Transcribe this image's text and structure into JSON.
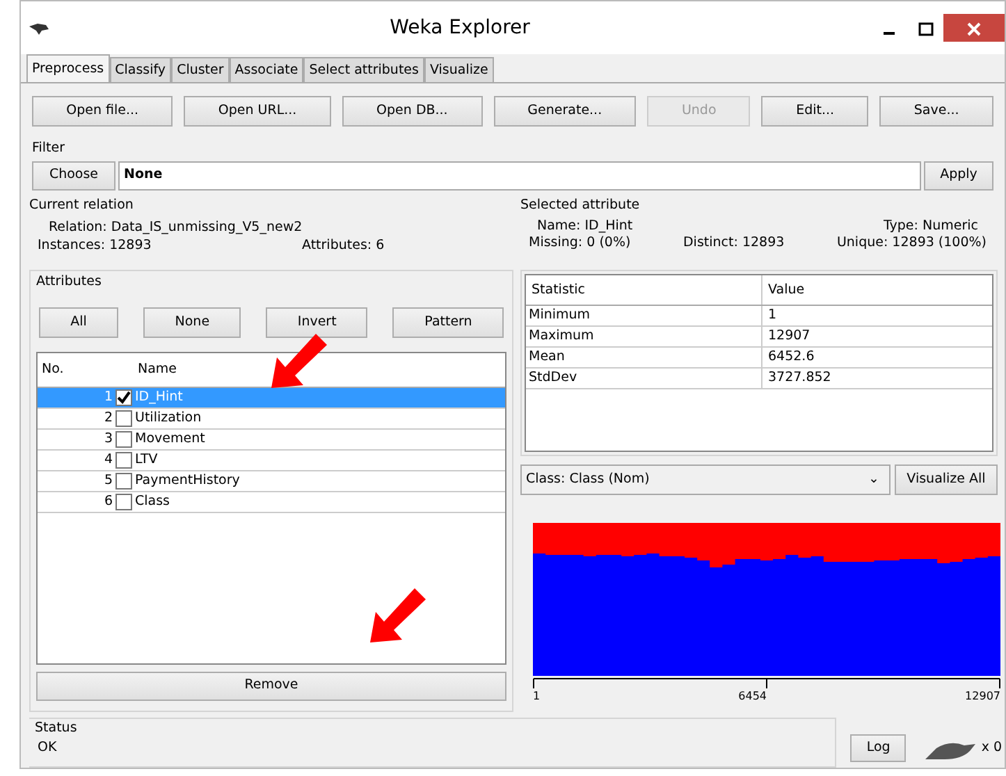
{
  "window": {
    "title": "Weka Explorer"
  },
  "tabs": [
    {
      "label": "Preprocess",
      "selected": true
    },
    {
      "label": "Classify",
      "selected": false
    },
    {
      "label": "Cluster",
      "selected": false
    },
    {
      "label": "Associate",
      "selected": false
    },
    {
      "label": "Select attributes",
      "selected": false
    },
    {
      "label": "Visualize",
      "selected": false
    }
  ],
  "toolbar": [
    {
      "label": "Open file...",
      "disabled": false
    },
    {
      "label": "Open URL...",
      "disabled": false
    },
    {
      "label": "Open DB...",
      "disabled": false
    },
    {
      "label": "Generate...",
      "disabled": false
    },
    {
      "label": "Undo",
      "disabled": true
    },
    {
      "label": "Edit...",
      "disabled": false
    },
    {
      "label": "Save...",
      "disabled": false
    }
  ],
  "filter": {
    "title": "Filter",
    "choose": "Choose",
    "value": "None",
    "apply": "Apply"
  },
  "current_relation": {
    "title": "Current relation",
    "relation_label": "Relation:",
    "relation": "Data_IS_unmissing_V5_new2",
    "instances_label": "Instances:",
    "instances": "12893",
    "attributes_label": "Attributes:",
    "attributes": "6"
  },
  "attributes": {
    "title": "Attributes",
    "buttons": [
      "All",
      "None",
      "Invert",
      "Pattern"
    ],
    "columns": [
      "No.",
      "Name"
    ],
    "rows": [
      {
        "no": "1",
        "checked": true,
        "name": "ID_Hint",
        "selected": true
      },
      {
        "no": "2",
        "checked": false,
        "name": "Utilization",
        "selected": false
      },
      {
        "no": "3",
        "checked": false,
        "name": "Movement",
        "selected": false
      },
      {
        "no": "4",
        "checked": false,
        "name": "LTV",
        "selected": false
      },
      {
        "no": "5",
        "checked": false,
        "name": "PaymentHistory",
        "selected": false
      },
      {
        "no": "6",
        "checked": false,
        "name": "Class",
        "selected": false
      }
    ],
    "remove": "Remove"
  },
  "selected_attribute": {
    "title": "Selected attribute",
    "name_label": "Name:",
    "name": "ID_Hint",
    "type_label": "Type:",
    "type": "Numeric",
    "missing_label": "Missing:",
    "missing": "0 (0%)",
    "distinct_label": "Distinct:",
    "distinct": "12893",
    "unique_label": "Unique:",
    "unique": "12893 (100%)",
    "columns": [
      "Statistic",
      "Value"
    ],
    "rows": [
      [
        "Minimum",
        "1"
      ],
      [
        "Maximum",
        "12907"
      ],
      [
        "Mean",
        "6452.6"
      ],
      [
        "StdDev",
        "3727.852"
      ]
    ]
  },
  "class_select": {
    "value": "Class: Class (Nom)",
    "caret": "⌄"
  },
  "visualize_all": "Visualize All",
  "histogram": {
    "axis_labels": [
      "1",
      "6454",
      "12907"
    ]
  },
  "status": {
    "title": "Status",
    "text": "OK",
    "log": "Log",
    "count": "x 0"
  }
}
